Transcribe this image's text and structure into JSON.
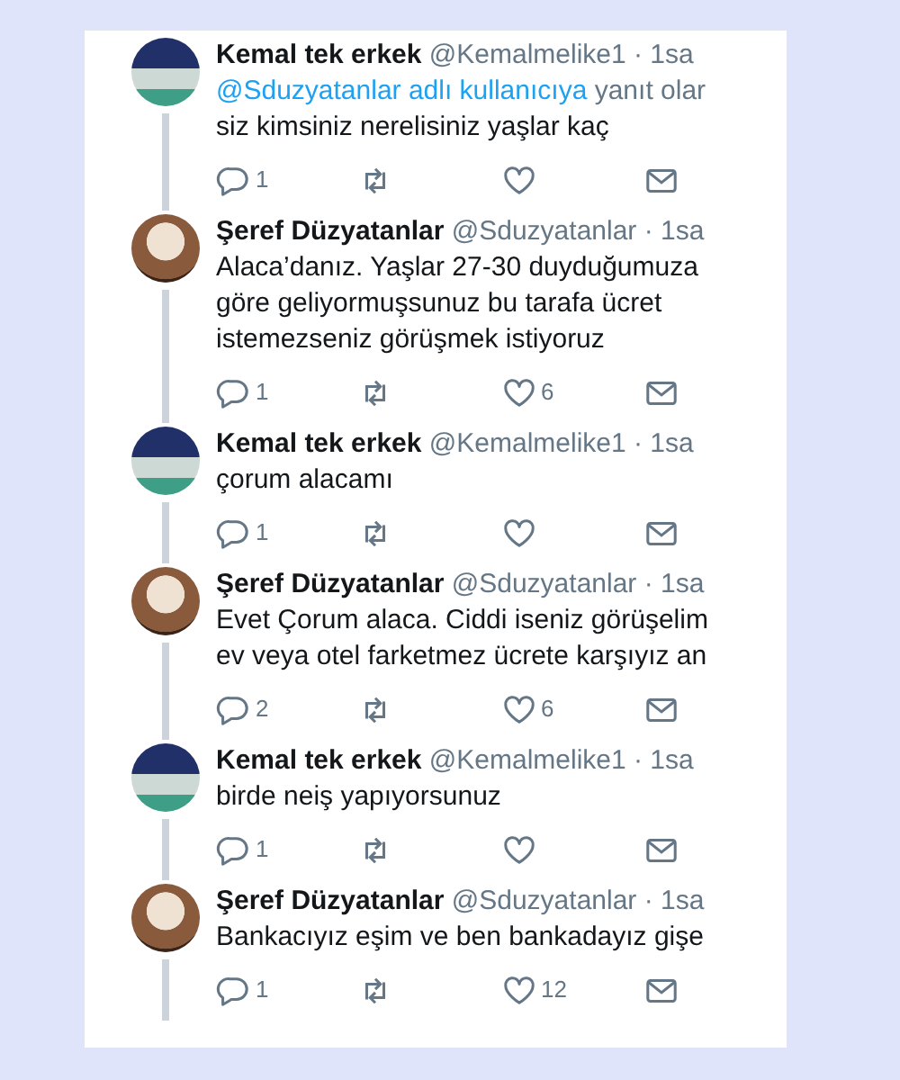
{
  "tweets": [
    {
      "author": "Kemal tek erkek",
      "handle": "@Kemalmelike1",
      "separator": "·",
      "time": "1sa",
      "kind": "dark",
      "reply_to": {
        "mention": "@Sduzyatanlar adlı kullanıcıya",
        "suffix": "yanıt olar"
      },
      "lines": [
        "siz kimsiniz nerelisiniz yaşlar kaç"
      ],
      "replies": "1"
    },
    {
      "author": "Şeref Düzyatanlar",
      "handle": "@Sduzyatanlar",
      "separator": "·",
      "time": "1sa",
      "kind": "warm",
      "lines": [
        "Alaca’danız. Yaşlar 27-30 duyduğumuza",
        "göre geliyormuşsunuz bu tarafa ücret",
        "istemezseniz görüşmek istiyoruz"
      ],
      "replies": "1",
      "likes": "6"
    },
    {
      "author": "Kemal tek erkek",
      "handle": "@Kemalmelike1",
      "separator": "·",
      "time": "1sa",
      "kind": "dark",
      "lines": [
        "çorum alacamı"
      ],
      "replies": "1"
    },
    {
      "author": "Şeref Düzyatanlar",
      "handle": "@Sduzyatanlar",
      "separator": "·",
      "time": "1sa",
      "kind": "warm",
      "lines": [
        "Evet Çorum alaca. Ciddi iseniz görüşelim",
        "ev veya otel farketmez ücrete karşıyız an"
      ],
      "replies": "2",
      "likes": "6"
    },
    {
      "author": "Kemal tek erkek",
      "handle": "@Kemalmelike1",
      "separator": "·",
      "time": "1sa",
      "kind": "dark",
      "lines": [
        "birde neiş yapıyorsunuz"
      ],
      "replies": "1"
    },
    {
      "author": "Şeref Düzyatanlar",
      "handle": "@Sduzyatanlar",
      "separator": "·",
      "time": "1sa",
      "kind": "warm",
      "lines": [
        "Bankacıyız eşim ve ben bankadayız gişe"
      ],
      "replies": "1",
      "likes": "12"
    }
  ]
}
